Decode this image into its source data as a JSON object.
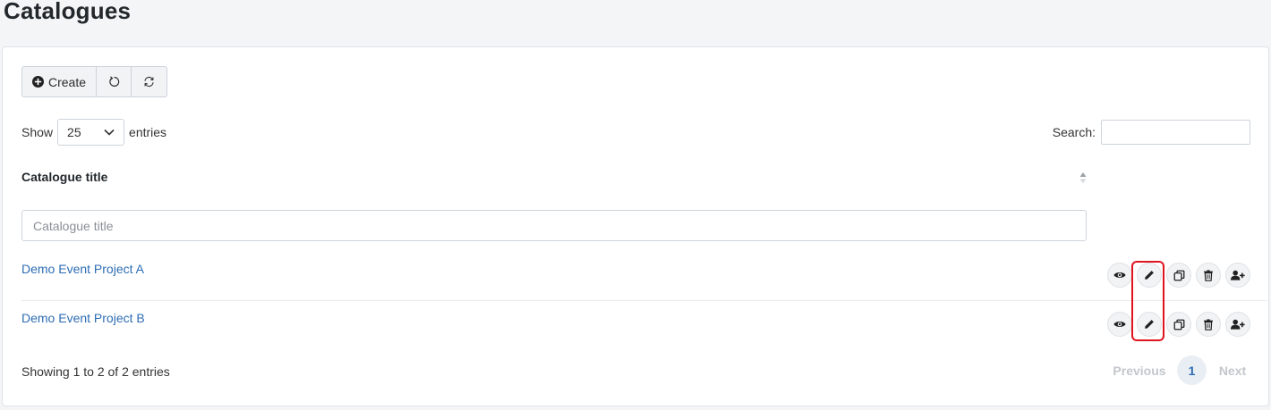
{
  "page": {
    "title": "Catalogues"
  },
  "toolbar": {
    "create_label": "Create",
    "reset_icon": "undo-icon",
    "refresh_icon": "sync-icon"
  },
  "length": {
    "show_label": "Show",
    "selected": "25",
    "entries_label": "entries"
  },
  "search": {
    "label": "Search:",
    "value": ""
  },
  "table": {
    "column_header": "Catalogue title",
    "filter_placeholder": "Catalogue title",
    "rows": [
      {
        "title": "Demo Event Project A"
      },
      {
        "title": "Demo Event Project B"
      }
    ],
    "actions": [
      "view-icon",
      "edit-icon",
      "copy-icon",
      "delete-icon",
      "add-user-icon"
    ]
  },
  "footer": {
    "info": "Showing 1 to 2 of 2 entries",
    "previous": "Previous",
    "current_page": "1",
    "next": "Next"
  },
  "colors": {
    "link": "#2d6db5",
    "highlight": "#e0141e"
  }
}
